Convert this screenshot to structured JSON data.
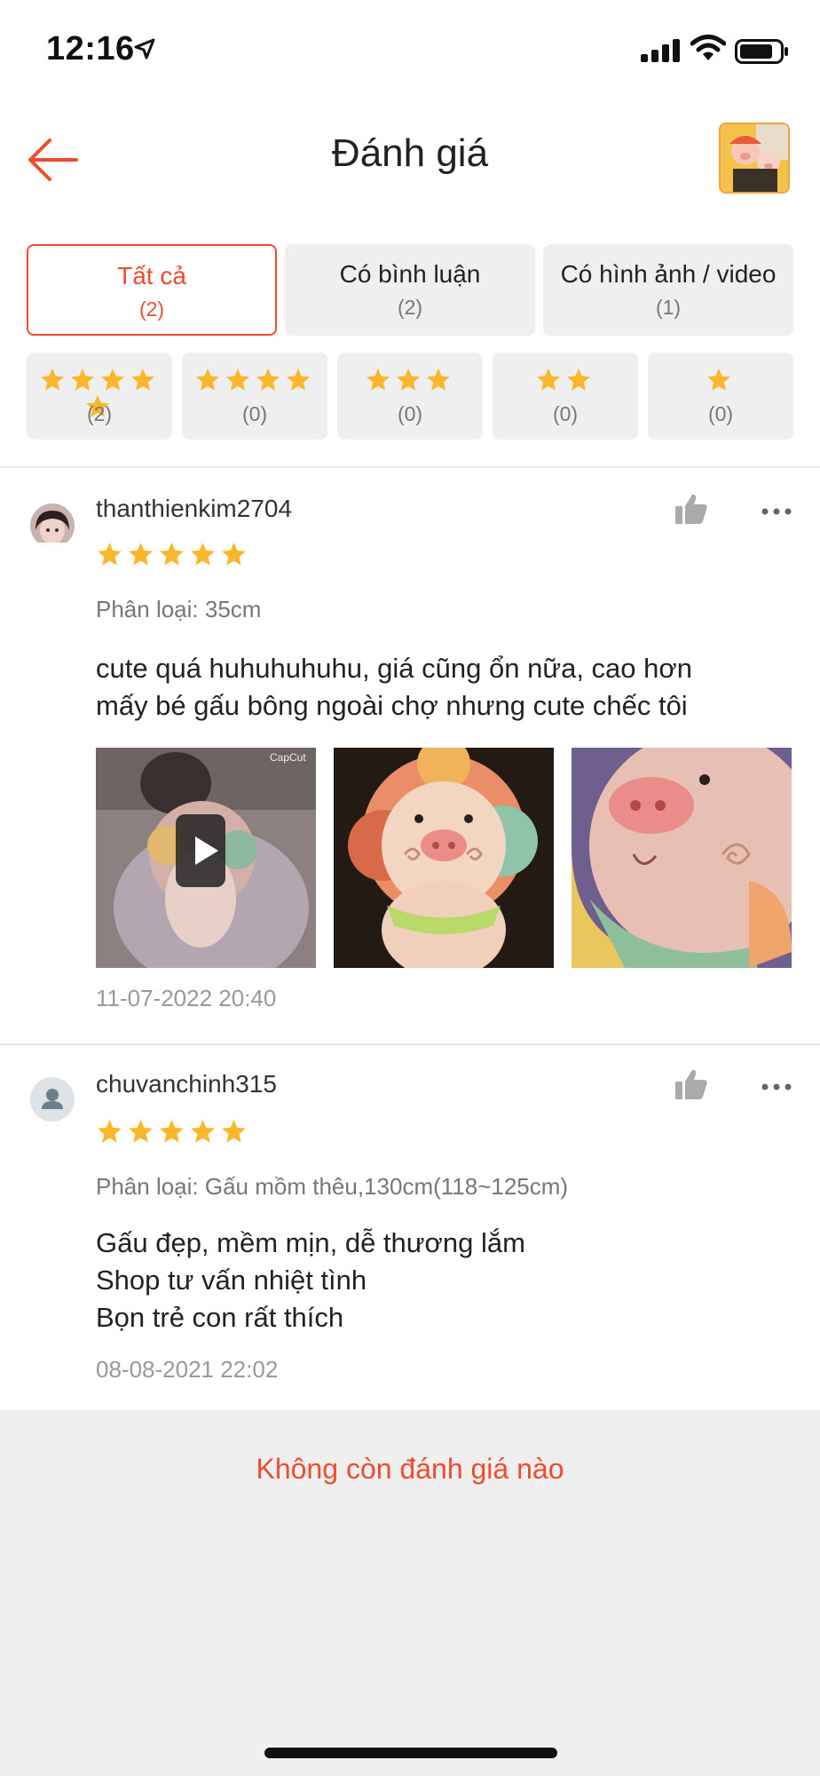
{
  "status_bar": {
    "time": "12:16"
  },
  "header": {
    "title": "Đánh giá"
  },
  "filter_tabs": [
    {
      "label": "Tất cả",
      "count": "(2)",
      "active": true
    },
    {
      "label": "Có bình luận",
      "count": "(2)",
      "active": false
    },
    {
      "label": "Có hình ảnh / video",
      "count": "(1)",
      "active": false
    }
  ],
  "star_filters": [
    {
      "stars": 5,
      "count": "(2)"
    },
    {
      "stars": 4,
      "count": "(0)"
    },
    {
      "stars": 3,
      "count": "(0)"
    },
    {
      "stars": 2,
      "count": "(0)"
    },
    {
      "stars": 1,
      "count": "(0)"
    }
  ],
  "reviews": [
    {
      "username": "thanthienkim2704",
      "rating": 5,
      "variant": "Phân loại: 35cm",
      "comment_lines": [
        "cute quá huhuhuhuhu, giá cũng ổn nữa, cao hơn",
        "mấy bé gấu bông ngoài chợ nhưng cute chếc tôi"
      ],
      "media_watermark": "CapCut",
      "date": "11-07-2022 20:40"
    },
    {
      "username": "chuvanchinh315",
      "rating": 5,
      "variant": "Phân loại: Gấu mồm thêu,130cm(118~125cm)",
      "comment_lines": [
        "Gấu đẹp, mềm mịn, dễ thương lắm",
        "Shop tư vấn nhiệt tình",
        "Bọn trẻ con rất thích"
      ],
      "date": "08-08-2021 22:02"
    }
  ],
  "footer": {
    "no_more": "Không còn đánh giá nào"
  },
  "colors": {
    "accent": "#ee4d2d",
    "star": "#fbb62b",
    "chip_bg": "#efefef"
  },
  "icons": [
    "location-arrow-icon",
    "signal-icon",
    "wifi-icon",
    "battery-icon",
    "back-arrow-icon",
    "thumbs-up-icon",
    "more-dots-icon",
    "play-icon",
    "star-icon",
    "default-avatar-icon"
  ]
}
